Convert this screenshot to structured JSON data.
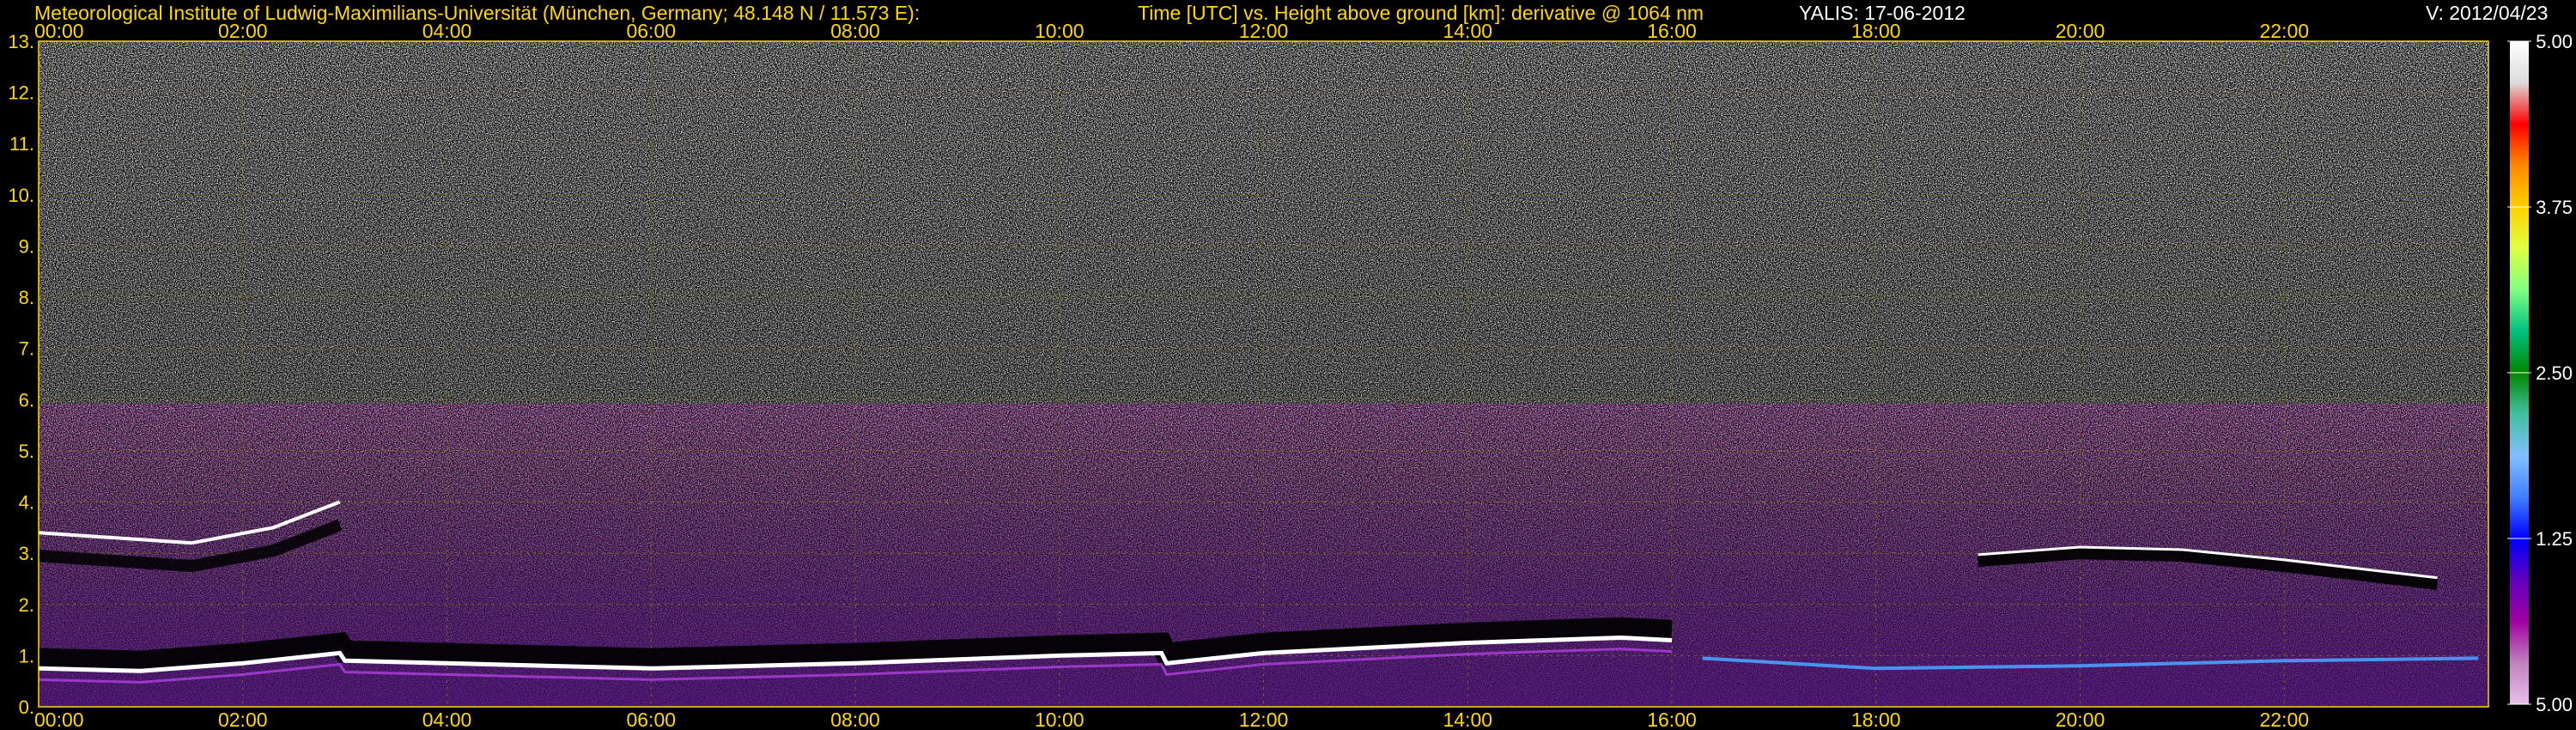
{
  "header": {
    "institute": "Meteorological Institute of Ludwig-Maximilians-Universität (München, Germany; 48.148 N / 11.573 E):",
    "title": "Time [UTC] vs. Height above ground [km]: derivative @ 1064 nm",
    "station": "YALIS: 17-06-2012",
    "version": "V: 2012/04/23"
  },
  "colors": {
    "background": "#000000",
    "label_yellow": "#ffd800",
    "grid_yellow": "#7a6a00",
    "text_white": "#ffffff"
  },
  "chart_data": {
    "type": "heatmap",
    "title": "Time [UTC] vs. Height above ground [km]: derivative @ 1064 nm",
    "xlim": [
      0,
      24
    ],
    "ylim": [
      0,
      13
    ],
    "x_ticks": [
      {
        "value": 0,
        "label": "00:00"
      },
      {
        "value": 2,
        "label": "02:00"
      },
      {
        "value": 4,
        "label": "04:00"
      },
      {
        "value": 6,
        "label": "06:00"
      },
      {
        "value": 8,
        "label": "08:00"
      },
      {
        "value": 10,
        "label": "10:00"
      },
      {
        "value": 12,
        "label": "12:00"
      },
      {
        "value": 14,
        "label": "14:00"
      },
      {
        "value": 16,
        "label": "16:00"
      },
      {
        "value": 18,
        "label": "18:00"
      },
      {
        "value": 20,
        "label": "20:00"
      },
      {
        "value": 22,
        "label": "22:00"
      }
    ],
    "y_ticks": [
      {
        "value": 0,
        "label": "0."
      },
      {
        "value": 1,
        "label": "1."
      },
      {
        "value": 2,
        "label": "2."
      },
      {
        "value": 3,
        "label": "3."
      },
      {
        "value": 4,
        "label": "4."
      },
      {
        "value": 5,
        "label": "5."
      },
      {
        "value": 6,
        "label": "6."
      },
      {
        "value": 7,
        "label": "7."
      },
      {
        "value": 8,
        "label": "8."
      },
      {
        "value": 9,
        "label": "9."
      },
      {
        "value": 10,
        "label": "10."
      },
      {
        "value": 11,
        "label": "11."
      },
      {
        "value": 12,
        "label": "12."
      },
      {
        "value": 13,
        "label": "13."
      }
    ],
    "grid": true,
    "boundary_layer_top_km": [
      {
        "t": 0.0,
        "h": 0.75
      },
      {
        "t": 1.0,
        "h": 0.7
      },
      {
        "t": 2.0,
        "h": 0.85
      },
      {
        "t": 2.95,
        "h": 1.05
      },
      {
        "t": 3.0,
        "h": 0.9
      },
      {
        "t": 4.0,
        "h": 0.85
      },
      {
        "t": 6.0,
        "h": 0.75
      },
      {
        "t": 8.0,
        "h": 0.85
      },
      {
        "t": 10.0,
        "h": 1.0
      },
      {
        "t": 11.0,
        "h": 1.05
      },
      {
        "t": 11.05,
        "h": 0.85
      },
      {
        "t": 12.0,
        "h": 1.05
      },
      {
        "t": 14.0,
        "h": 1.25
      },
      {
        "t": 15.5,
        "h": 1.35
      },
      {
        "t": 16.0,
        "h": 1.3
      }
    ],
    "residual_layer_km": [
      {
        "t": 0.0,
        "h": 3.4
      },
      {
        "t": 1.5,
        "h": 3.2
      },
      {
        "t": 2.3,
        "h": 3.5
      },
      {
        "t": 2.95,
        "h": 4.0
      }
    ],
    "evening_layer_km": [
      {
        "t": 19.0,
        "h": 2.85
      },
      {
        "t": 20.0,
        "h": 3.0
      },
      {
        "t": 21.0,
        "h": 2.95
      },
      {
        "t": 22.0,
        "h": 2.75
      },
      {
        "t": 23.5,
        "h": 2.4
      }
    ],
    "colorbar": {
      "labels": [
        "5.00",
        "3.75",
        "2.50",
        "1.25",
        "5.00"
      ],
      "stops": [
        "#ffffff",
        "#dcdcdc",
        "#ff0000",
        "#ff8800",
        "#ffd000",
        "#e0ff40",
        "#80ff80",
        "#00c080",
        "#008800",
        "#40c0a0",
        "#80c0ff",
        "#4080ff",
        "#0000ff",
        "#6000c0",
        "#a000a0",
        "#c080c0",
        "#e8c0e8"
      ]
    }
  }
}
